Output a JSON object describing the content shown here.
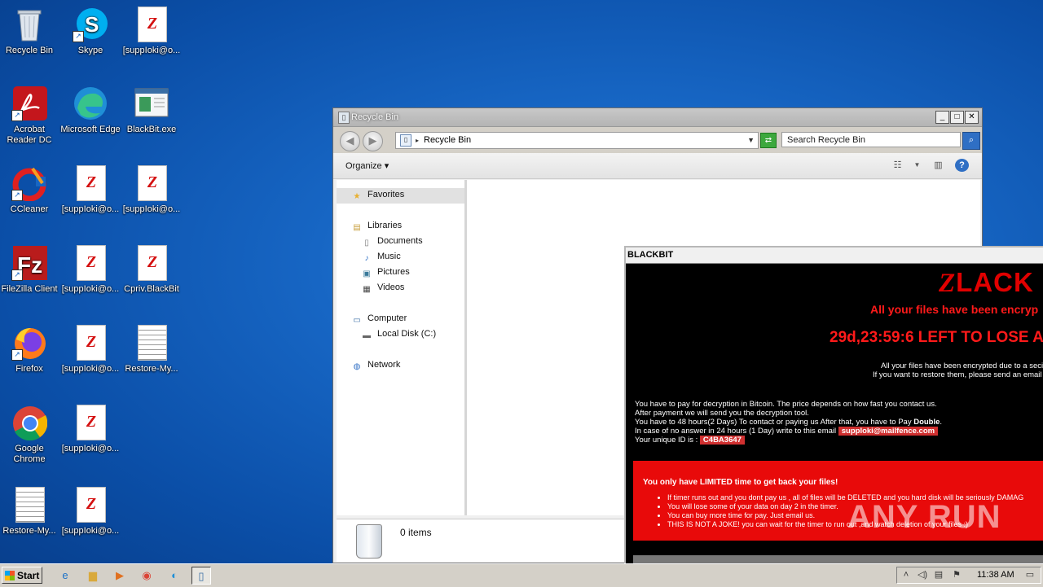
{
  "desktop": {
    "icons": [
      {
        "label": "Recycle Bin"
      },
      {
        "label": "Skype"
      },
      {
        "label": "[suppIoki@o..."
      },
      {
        "label": "Acrobat Reader DC"
      },
      {
        "label": "Microsoft Edge"
      },
      {
        "label": "BlackBit.exe"
      },
      {
        "label": "CCleaner"
      },
      {
        "label": "[suppIoki@o..."
      },
      {
        "label": "[suppIoki@o..."
      },
      {
        "label": "FileZilla Client"
      },
      {
        "label": "[suppIoki@o..."
      },
      {
        "label": "Cpriv.BlackBit"
      },
      {
        "label": "Firefox"
      },
      {
        "label": "[suppIoki@o..."
      },
      {
        "label": "Restore-My..."
      },
      {
        "label": "Google Chrome"
      },
      {
        "label": "[suppIoki@o..."
      },
      {
        "label": "Restore-My..."
      },
      {
        "label": "[suppIoki@o..."
      }
    ]
  },
  "explorer": {
    "title": "Recycle Bin",
    "address": "Recycle Bin",
    "search_placeholder": "Search Recycle Bin",
    "organize_label": "Organize",
    "nav": {
      "favorites": "Favorites",
      "libraries": "Libraries",
      "documents": "Documents",
      "music": "Music",
      "pictures": "Pictures",
      "videos": "Videos",
      "computer": "Computer",
      "local_disk": "Local Disk (C:)",
      "network": "Network"
    },
    "item_count": "0 items"
  },
  "ransom": {
    "title": "BLACKBIT",
    "logo_z": "Z",
    "logo_rest": "LACK I",
    "headline": "All your files have been encryp",
    "timer": "29d,23:59:6 LEFT TO LOSE A",
    "line1": "All your files have been encrypted due to a seci",
    "line2": "If you want to restore them, please send an email",
    "para1": "You have to pay for decryption in Bitcoin. The price depends on how fast you contact us.",
    "para2": "After payment we will send you the decryption tool.",
    "para3_pre": "You have to 48 hours(2 Days) To contact or paying us After that, you have to Pay ",
    "para3_bold": "Double",
    "para3_post": ".",
    "para4": "In case of no answer in 24 hours (1 Day) write to this email",
    "email": "suppIoki@mailfence.com",
    "uid_label": "Your unique ID is :",
    "uid": "C4BA3647",
    "box_heading": "You only have LIMITED time to get back your files!",
    "bullets": [
      "If timer runs out and you dont pay us , all of files will be DELETED and you hard disk will be seriously DAMAG",
      "You will lose some of your data on day 2 in the timer.",
      "You can buy more time for pay. Just email us.",
      "THIS IS NOT A JOKE! you can wait for the timer to run out ,and watch deletion of your files :)"
    ]
  },
  "watermark": "ANY RUN",
  "taskbar": {
    "start_label": "Start",
    "clock": "11:38 AM"
  }
}
